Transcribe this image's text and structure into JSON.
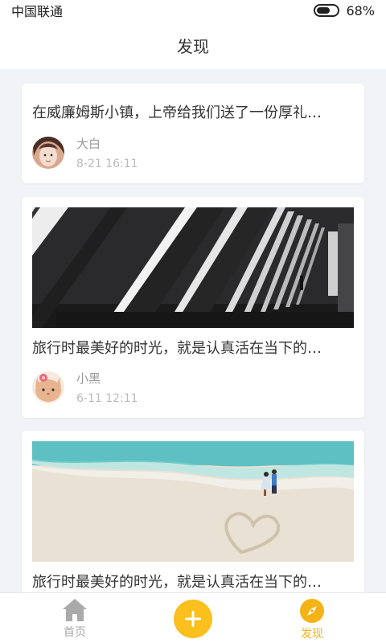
{
  "status_bar": {
    "carrier": "中国联通",
    "battery_percent": "68%",
    "battery_level": 0.68
  },
  "header": {
    "title": "发现"
  },
  "feed": {
    "posts": [
      {
        "title": "在威廉姆斯小镇，上帝给我们送了一份厚礼…",
        "author": "大白",
        "time": "8-21  16:11"
      },
      {
        "title": "旅行时最美好的时光，就是认真活在当下的…",
        "author": "小黑",
        "time": "6-11  12:11",
        "image": "corridor-photo"
      },
      {
        "title": "旅行时最美好的时光，就是认真活在当下的…",
        "image": "beach-photo"
      }
    ]
  },
  "tab_bar": {
    "home_label": "首页",
    "discover_label": "发现",
    "active_color": "#f5b316",
    "inactive_color": "#aaaaaa",
    "add_color": "#fbbf1e"
  }
}
